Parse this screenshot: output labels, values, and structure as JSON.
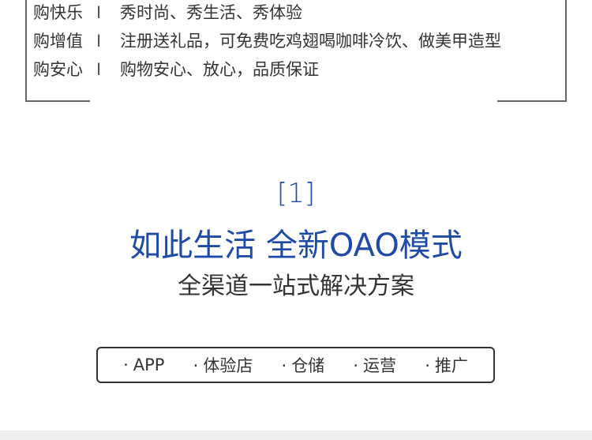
{
  "features": [
    {
      "label": "购快乐",
      "separator": "I",
      "text": "秀时尚、秀生活、秀体验"
    },
    {
      "label": "购增值",
      "separator": "I",
      "text": "注册送礼品，可免费吃鸡翅喝咖啡冷饮、做美甲造型"
    },
    {
      "label": "购安心",
      "separator": "I",
      "text": "购物安心、放心，品质保证"
    }
  ],
  "section": {
    "number": "[1]",
    "headline": "如此生活 全新OAO模式",
    "subheadline": "全渠道一站式解决方案"
  },
  "tags": [
    {
      "dot": "·",
      "label": "APP"
    },
    {
      "dot": "·",
      "label": "体验店"
    },
    {
      "dot": "·",
      "label": "仓储"
    },
    {
      "dot": "·",
      "label": "运营"
    },
    {
      "dot": "·",
      "label": "推广"
    }
  ],
  "colors": {
    "accent": "#1e4aa8",
    "text": "#333333",
    "border": "#666666"
  }
}
